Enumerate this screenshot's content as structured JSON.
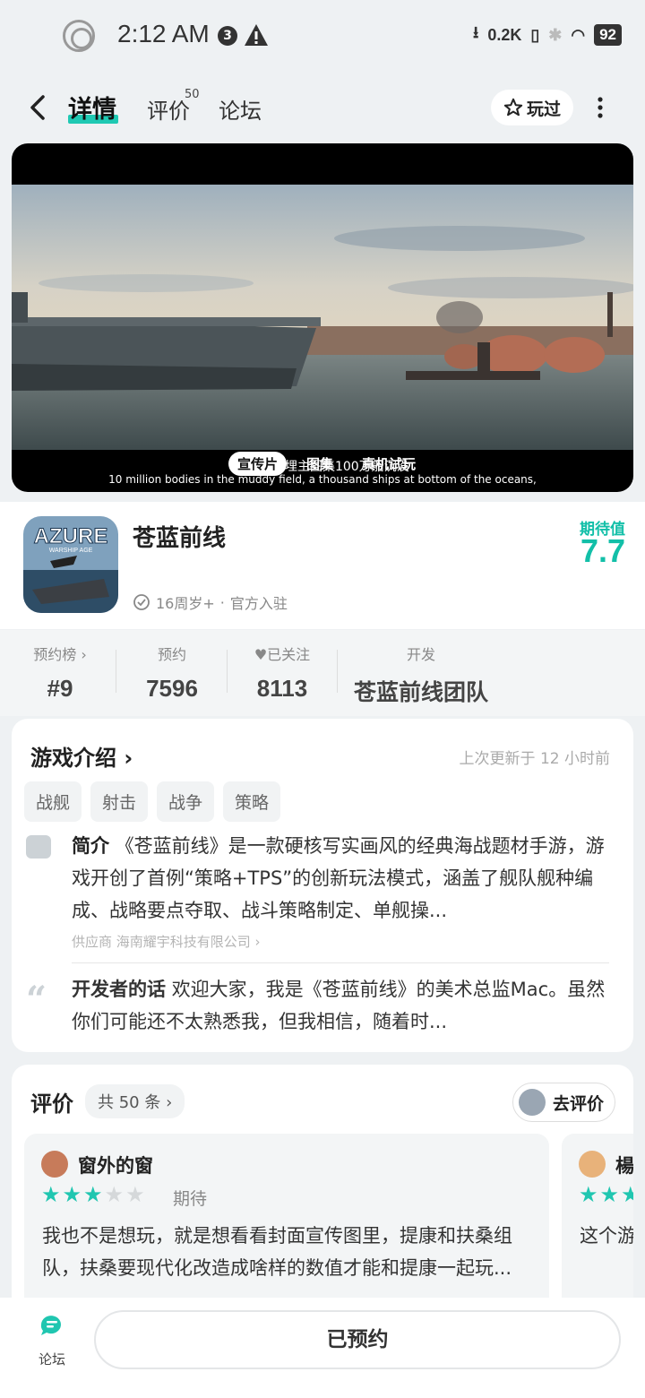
{
  "status_bar": {
    "time": "2:12 AM",
    "notif_count": "3",
    "net_speed": "0.2K",
    "wifi_index": "6",
    "battery": "92"
  },
  "header": {
    "tabs": [
      {
        "label": "详情",
        "active": true
      },
      {
        "label": "评价",
        "sup": "50"
      },
      {
        "label": "论坛"
      }
    ],
    "played_label": "玩过"
  },
  "video": {
    "subtitle_cn": "100万人埋主图集100万船沉没",
    "subtitle_en": "10 million bodies in the muddy field, a thousand ships at bottom of the oceans,",
    "tabs": [
      "宣传片",
      "图集",
      "真机试玩"
    ]
  },
  "game": {
    "title": "苍蓝前线",
    "age": "16周岁+",
    "official": "官方入驻",
    "icon_text": "AZURE",
    "icon_subtext": "WARSHIP AGE",
    "expect_label": "期待值",
    "expect_value": "7.7"
  },
  "stats": [
    {
      "label": "预约榜 ›",
      "value": "#9"
    },
    {
      "label": "预约",
      "value": "7596"
    },
    {
      "label": "♥已关注",
      "value": "8113"
    },
    {
      "label": "开发",
      "value": "苍蓝前线团队"
    }
  ],
  "intro": {
    "title": "游戏介绍 ›",
    "updated": "上次更新于 12 小时前",
    "tags": [
      "战舰",
      "射击",
      "战争",
      "策略"
    ],
    "desc_label": "简介",
    "desc_text": "《苍蓝前线》是一款硬核写实画风的经典海战题材手游，游戏开创了首例“策略+TPS”的创新玩法模式，涵盖了舰队舰种编成、战略要点夺取、战斗策略制定、单舰操...",
    "supplier": "供应商 海南耀宇科技有限公司 ›",
    "dev_label": "开发者的话",
    "dev_text": "欢迎大家，我是《苍蓝前线》的美术总监Mac。虽然你们可能还不太熟悉我，但我相信，随着时..."
  },
  "reviews": {
    "title": "评价",
    "count": "共 50 条 ›",
    "go_review": "去评价",
    "items": [
      {
        "name": "窗外的窗",
        "rating": 3,
        "status": "期待",
        "text": "我也不是想玩，就是想看看封面宣传图里，提康和扶桑组队，扶桑要现代化改造成啥样的数值才能和提康一起玩..."
      },
      {
        "name": "楊",
        "rating": 3,
        "text": "这个游没有后了"
      }
    ]
  },
  "bottom": {
    "forum_label": "论坛",
    "reserve_label": "已预约"
  },
  "colors": {
    "accent": "#12bfa8",
    "star": "#20c6b0"
  }
}
